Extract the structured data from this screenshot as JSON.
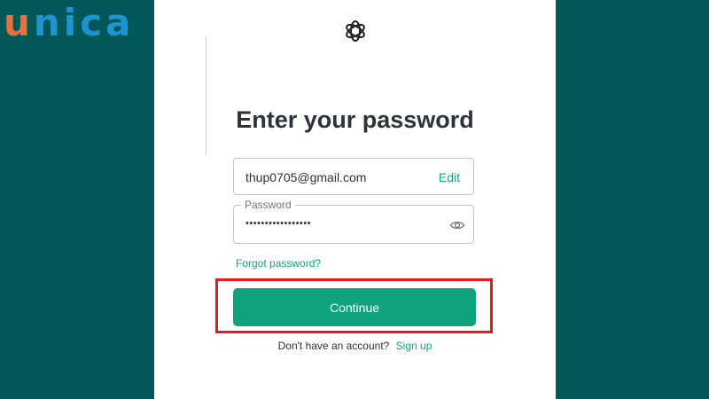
{
  "brand": {
    "first_letter": "u",
    "rest": "nica",
    "colors": {
      "first": "#e8703b",
      "rest": "#1d93d2"
    }
  },
  "logo": {
    "icon": "openai-logo-icon"
  },
  "title": "Enter your password",
  "email": {
    "value": "thup0705@gmail.com",
    "edit_label": "Edit"
  },
  "password": {
    "label": "Password",
    "masked_value": "•••••••••••••••••",
    "toggle_icon": "eye-icon"
  },
  "forgot_link": "Forgot password?",
  "continue_button": "Continue",
  "signup": {
    "prompt": "Don't have an account?",
    "link": "Sign up"
  },
  "colors": {
    "accent": "#10a37f",
    "background": "#025758",
    "highlight": "#e21c1c"
  }
}
